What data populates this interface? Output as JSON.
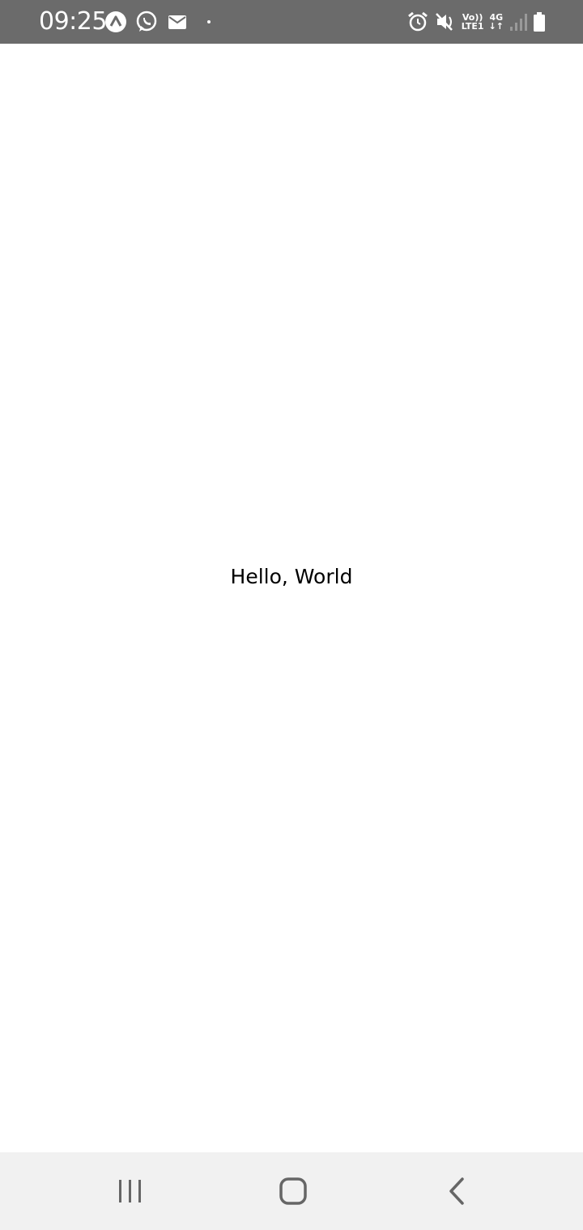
{
  "status_bar": {
    "time": "09:25",
    "left_icons": [
      "app-notification-icon",
      "whatsapp-icon",
      "mail-icon",
      "more-notifications-dot-icon"
    ],
    "right_icons": [
      "alarm-icon",
      "mute-icon",
      "volte-icon",
      "4g-icon",
      "signal-icon",
      "battery-icon"
    ],
    "volte_top": "Vo))",
    "volte_bottom": "LTE1",
    "network_top": "4G",
    "network_bottom": "↓↑"
  },
  "main": {
    "text": "Hello, World"
  },
  "nav_bar": {
    "buttons": [
      "recent-apps-icon",
      "home-icon",
      "back-icon"
    ]
  },
  "colors": {
    "status_bar_bg": "#6b6b6b",
    "nav_bar_bg": "#f1f1f1",
    "content_bg": "#ffffff",
    "text": "#000000"
  }
}
